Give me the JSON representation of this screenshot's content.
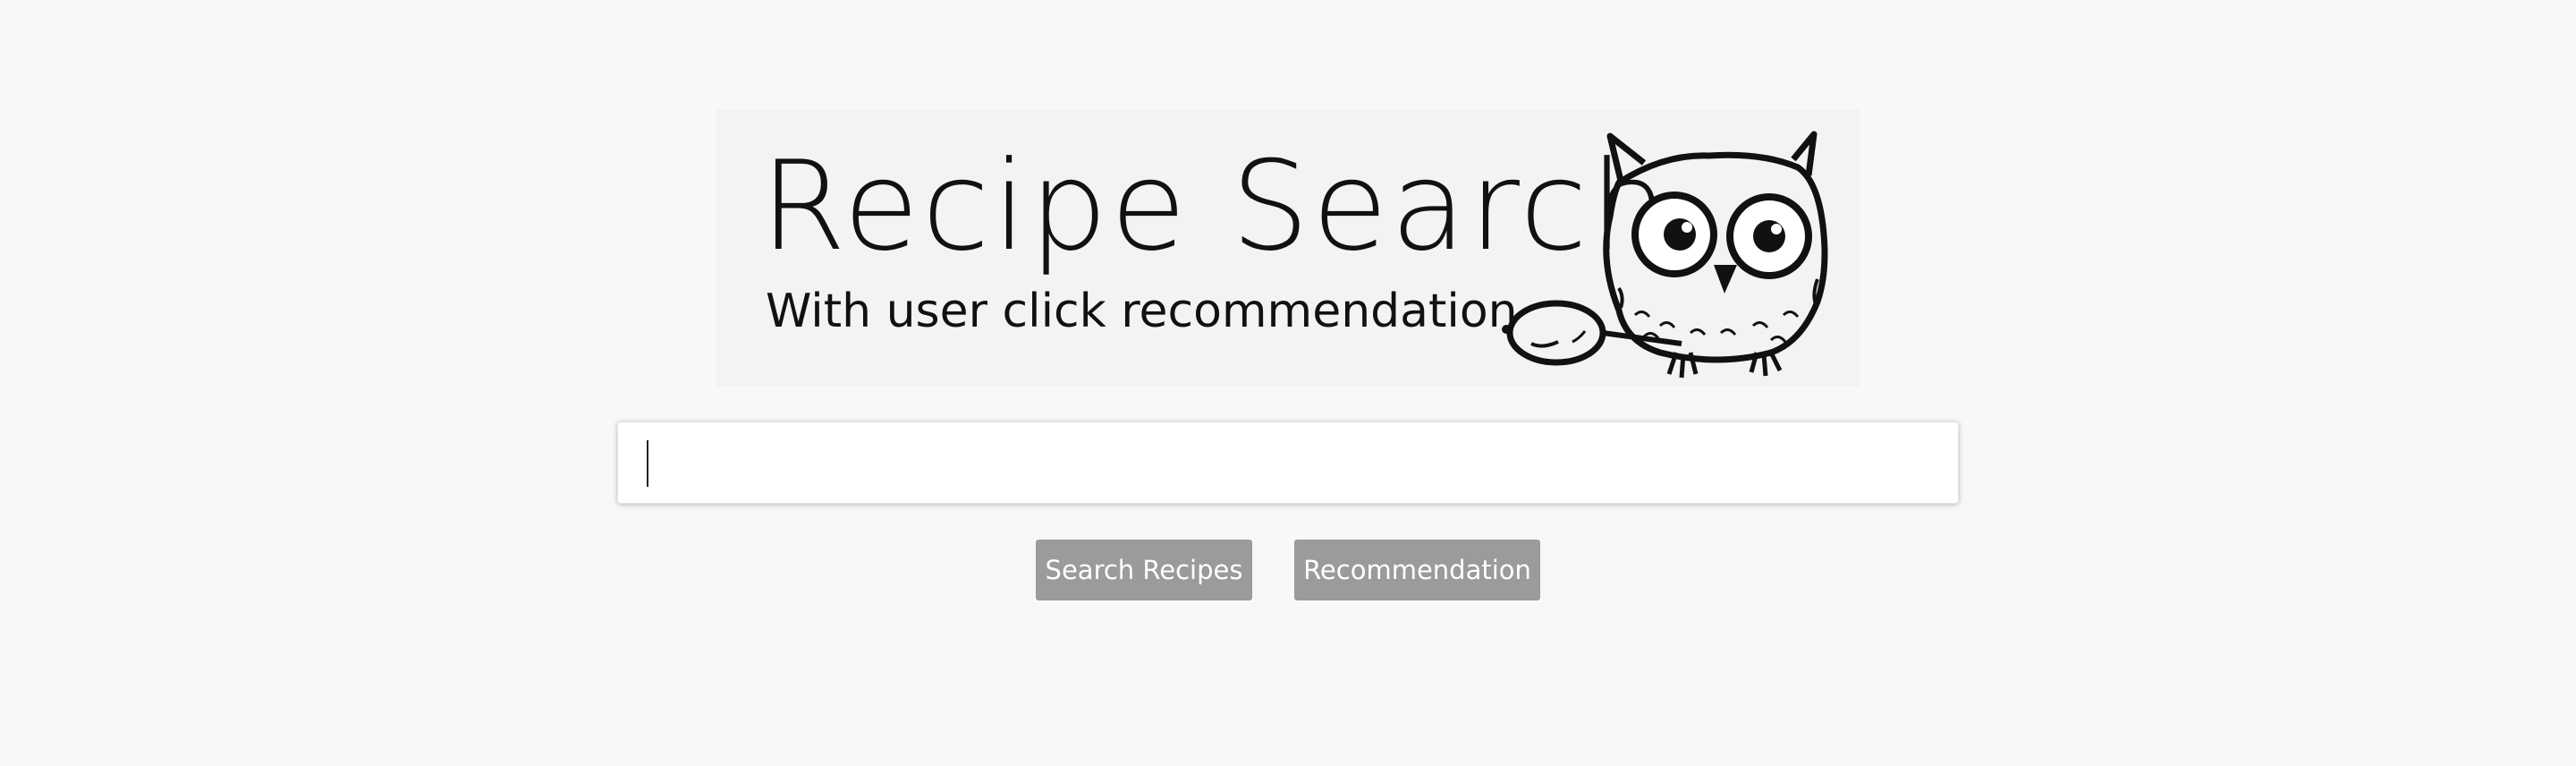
{
  "logo": {
    "title": "Recipe Search",
    "subtitle": "With user click  recommendation",
    "mascot_icon": "owl-with-magnifying-glass-icon"
  },
  "search": {
    "value": "",
    "placeholder": ""
  },
  "buttons": {
    "search_label": "Search Recipes",
    "recommend_label": "Recommendation"
  },
  "colors": {
    "background": "#f8f8f8",
    "button": "#9b9b9b",
    "button_text": "#ffffff"
  }
}
